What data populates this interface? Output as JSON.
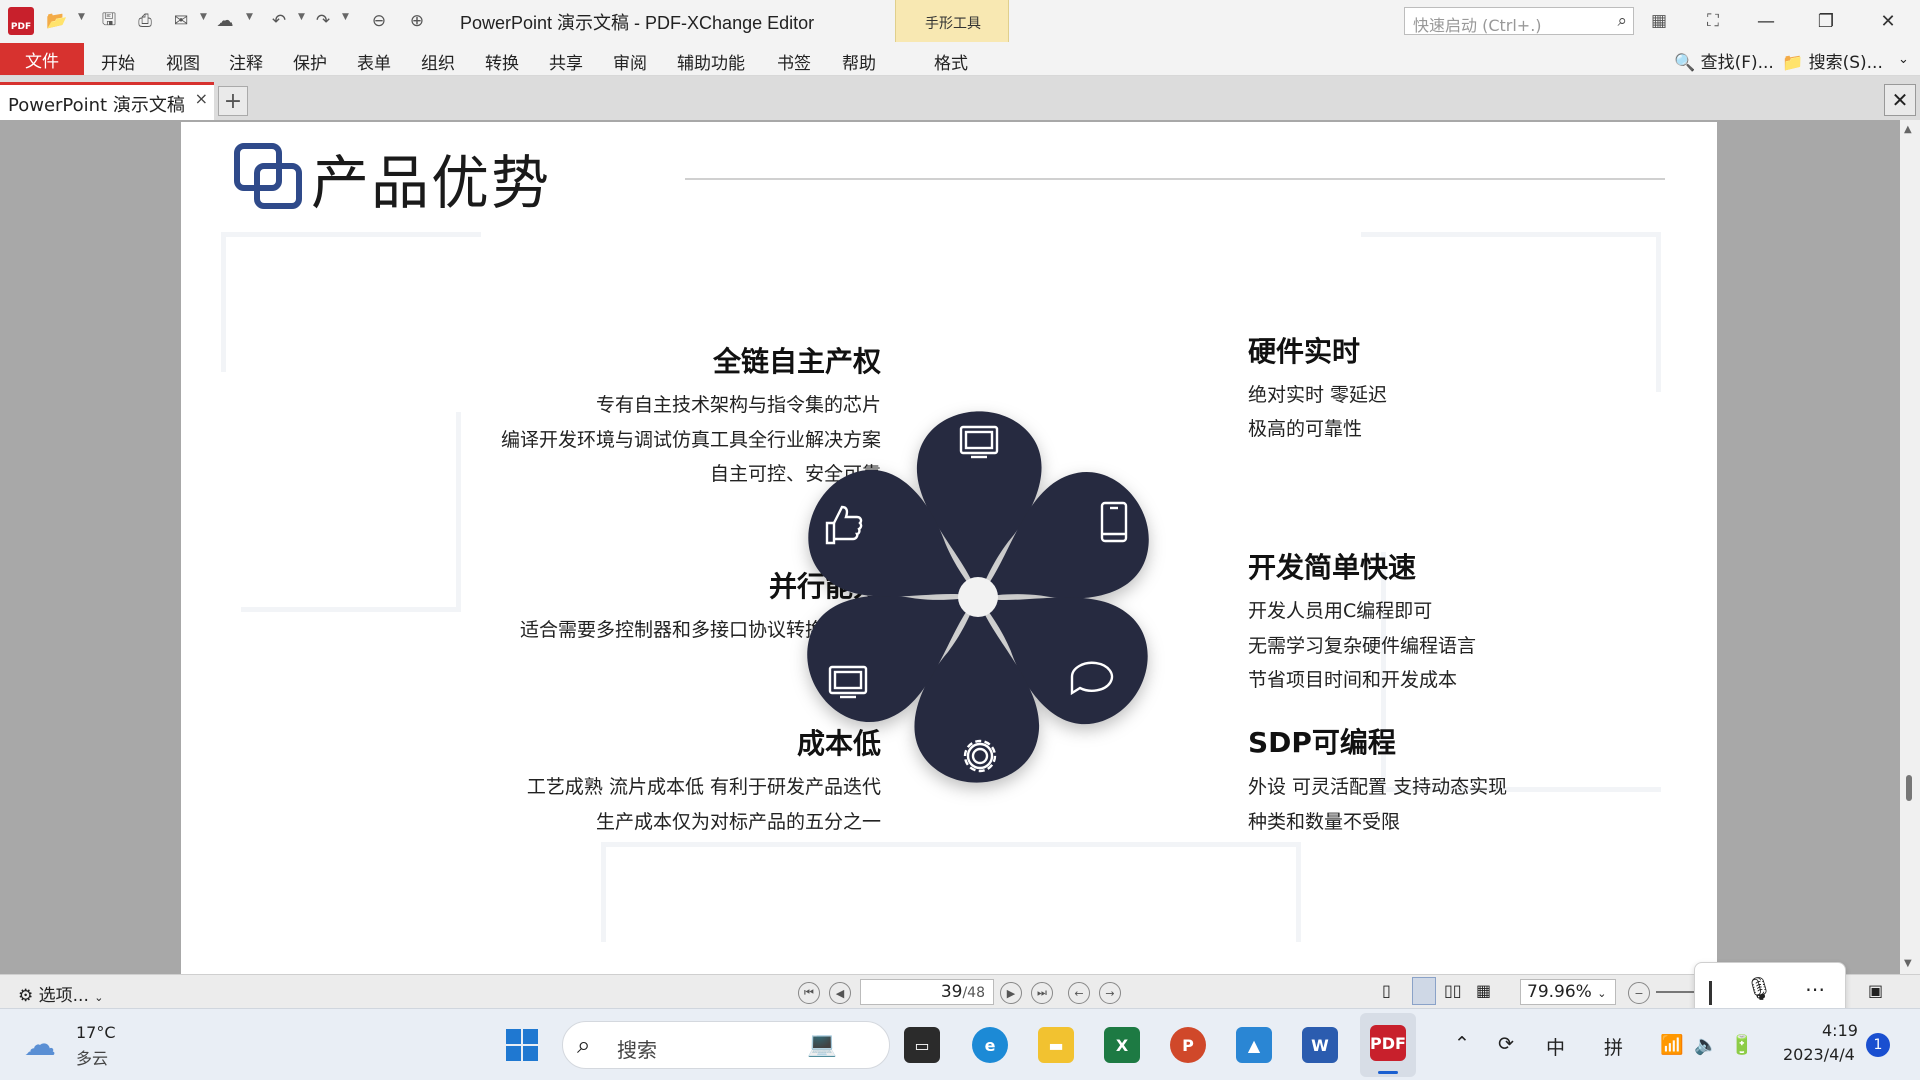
{
  "window": {
    "title": "PowerPoint 演示文稿 - PDF-XChange Editor",
    "context_group": "手形工具",
    "quick_launch_placeholder": "快速启动 (Ctrl+.)"
  },
  "menu": {
    "file": "文件",
    "items": [
      "开始",
      "视图",
      "注释",
      "保护",
      "表单",
      "组织",
      "转换",
      "共享",
      "审阅",
      "辅助功能",
      "书签",
      "帮助",
      "格式"
    ],
    "find": "查找(F)...",
    "search": "搜索(S)..."
  },
  "tabs": {
    "doc_tab": "PowerPoint 演示文稿",
    "close": "×",
    "new": "+"
  },
  "slide": {
    "title": "产品优势",
    "left": [
      {
        "heading": "全链自主产权",
        "lines": [
          "专有自主技术架构与指令集的芯片",
          "编译开发环境与调试仿真工具全行业解决方案",
          "自主可控、安全可靠"
        ]
      },
      {
        "heading": "并行能力",
        "lines": [
          "适合需要多控制器和多接口协议转换的场景"
        ]
      },
      {
        "heading": "成本低",
        "lines": [
          "工艺成熟   流片成本低  有利于研发产品迭代",
          "生产成本仅为对标产品的五分之一"
        ]
      }
    ],
    "right": [
      {
        "heading": "硬件实时",
        "lines": [
          "绝对实时    零延迟",
          "极高的可靠性"
        ]
      },
      {
        "heading": "开发简单快速",
        "lines": [
          "开发人员用C编程即可",
          "无需学习复杂硬件编程语言",
          "节省项目时间和开发成本"
        ]
      },
      {
        "heading": "SDP可编程",
        "lines": [
          "外设  可灵活配置   支持动态实现",
          "种类和数量不受限"
        ]
      }
    ],
    "petal_icons": [
      "monitor-icon",
      "phone-icon",
      "chat-icon",
      "gear-icon",
      "monitor-icon",
      "thumbs-up-icon"
    ],
    "petal_color": "#262a3f",
    "accent_color": "#2f4a8a"
  },
  "status": {
    "options": "选项...",
    "page_current": "39",
    "page_total": "/48",
    "zoom": "79.96%"
  },
  "taskbar": {
    "temperature": "17°C",
    "weather": "多云",
    "search": "搜索",
    "ime_lang": "中",
    "ime_mode": "拼",
    "time": "4:19",
    "date": "2023/4/4",
    "notifications": "1"
  }
}
